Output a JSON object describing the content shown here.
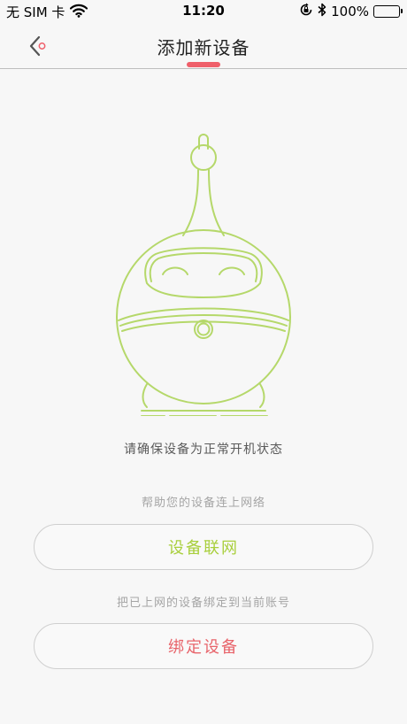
{
  "status_bar": {
    "carrier": "无 SIM 卡",
    "time": "11:20",
    "battery": "100%",
    "battery_level": 1.0
  },
  "nav": {
    "title": "添加新设备",
    "back_icon": "chevron-left-icon"
  },
  "main": {
    "status_text": "请确保设备为正常开机状态",
    "network_hint": "帮助您的设备连上网络",
    "network_button": "设备联网",
    "bind_hint": "把已上网的设备绑定到当前账号",
    "bind_button": "绑定设备"
  },
  "colors": {
    "accent_green": "#a9cf3d",
    "accent_red": "#e8646b",
    "indicator": "#ef5f6a"
  }
}
